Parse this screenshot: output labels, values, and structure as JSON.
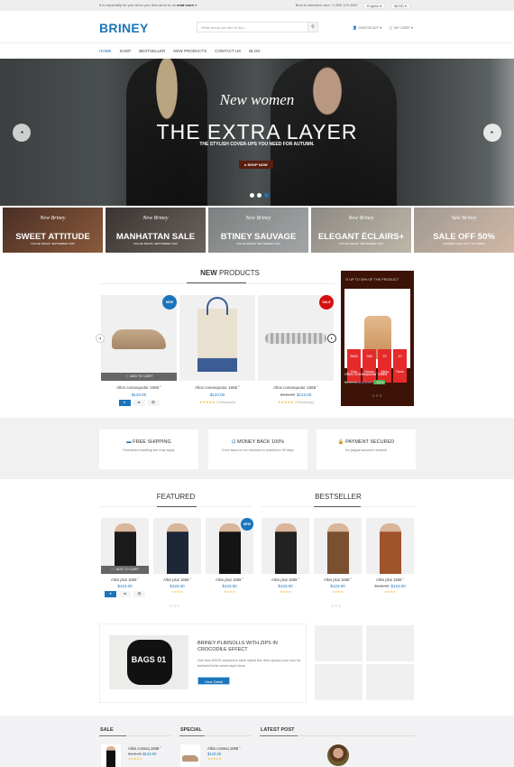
{
  "topbar": {
    "message": "It is especially for you when you first came to us",
    "read_more": "read more »",
    "support": "Best in intensive care +1.800 123 4567",
    "language": "English",
    "currency": "$USD"
  },
  "header": {
    "logo": "BRINEY",
    "search_placeholder": "What would you like to find ...",
    "checkout": "CHECKOUT",
    "cart": "MY CART"
  },
  "nav": [
    "HOME",
    "SHOP",
    "BESTSELLER",
    "NEW PRODUCTS",
    "CONTACT US",
    "BLOG"
  ],
  "hero": {
    "script": "New women",
    "title": "THE EXTRA LAYER",
    "subtitle": "THE STYLISH COVER-UPS YOU NEED FOR AUTUMN.",
    "button": "▸ SHOP NOW",
    "active_slide": 3,
    "slide_count": 3
  },
  "banners": [
    {
      "script": "New Briney",
      "title": "SWEET ATTITUDE",
      "sub": "VOGUE BRAZIL SEPTEMBER 2015",
      "c1": "#4a2f25",
      "c2": "#8b5a3c"
    },
    {
      "script": "New Briney",
      "title": "MANHATTAN SALE",
      "sub": "VOGUE BRAZIL SEPTEMBER 2015",
      "c1": "#3a3533",
      "c2": "#6b625c"
    },
    {
      "script": "New Briney",
      "title": "BTINEY SAUVAGE",
      "sub": "VOGUE BRAZIL SEPTEMBER 2015",
      "c1": "#7d7f80",
      "c2": "#a3a5a6"
    },
    {
      "script": "New Briney",
      "title": "ELEGANT ÉCLAIRS+",
      "sub": "VOGUE BRAZIL SEPTEMBER 2015",
      "c1": "#8d8a84",
      "c2": "#bdb6a8"
    },
    {
      "script": "Sale Briney",
      "title": "SALE OFF 50%",
      "sub": "SUMMER SALE ONLY IN TOWER",
      "c1": "#a09a92",
      "c2": "#d3b8a5"
    }
  ],
  "new_products": {
    "title_bold": "NEW",
    "title_rest": " PRODUCTS",
    "items": [
      {
        "name": "Allos consequutur 1668 ˚",
        "price": "$123.00",
        "old_price": "",
        "badge": "NEW",
        "badge_color": "#1b75bb",
        "add_to_cart": "🛒 ADD TO CART",
        "rating": "",
        "reviews": ""
      },
      {
        "name": "Allos consequutur 1668 ˚",
        "price": "$123.00",
        "old_price": "",
        "badge": "",
        "rating": "★★★★★",
        "reviews": "3 Review(s)"
      },
      {
        "name": "Allos consequutur 1668 ˚",
        "price": "$123.00",
        "old_price": "$145.00",
        "badge": "SALE",
        "badge_color": "#d40f0f",
        "rating": "★★★★★",
        "reviews": "3 Review(s)"
      }
    ],
    "actions": [
      "♥",
      "⇄",
      "👁"
    ]
  },
  "deal": {
    "header": "UP TO 30% OF THE PRODUCT",
    "countdown": [
      {
        "value": "9865",
        "unit": "Day"
      },
      {
        "value": "268",
        "unit": "Hours"
      },
      {
        "value": "23",
        "unit": "Mins"
      },
      {
        "value": "10",
        "unit": "Secs"
      }
    ],
    "name": "Allos consequutur 1668 ˚",
    "old_price": "$145.00",
    "price": "$123.00",
    "discount": "-30%",
    "dots": "○○○"
  },
  "policies": [
    {
      "icon": "▬",
      "title": "FREE SHIPPING",
      "desc": "Oversized handling fee may apply"
    },
    {
      "icon": "⊡",
      "title": "MONEY BACK 100%",
      "desc": "If the issue is not resolved in maximum 30 days"
    },
    {
      "icon": "🔒",
      "title": "PAYMENT SECURED",
      "desc": "No paypal account needed!"
    }
  ],
  "featured": {
    "title": "FEATURED",
    "items": [
      {
        "name": "Allos plus 1668 ˚",
        "price": "$123.00",
        "old_price": "",
        "badge": "",
        "add_to_cart": "🛒 ADD TO CART"
      },
      {
        "name": "Allos plus 1668 ˚",
        "price": "$123.00",
        "old_price": "",
        "badge": "",
        "rating": "★★★★"
      },
      {
        "name": "Allos plus 1668 ˚",
        "price": "$123.00",
        "old_price": "",
        "badge": "NEW",
        "rating": "★★★★"
      },
      {
        "name": "Allos plus 1668 ˚",
        "price": "$123.00",
        "old_price": "",
        "badge": "",
        "rating": "★★★★"
      }
    ],
    "dots": "○○○"
  },
  "bestseller": {
    "title": "BESTSELLER",
    "items": [
      {
        "name": "Allos plus 1668 ˚",
        "price": "$123.00",
        "old_price": "",
        "rating": "★★★★"
      },
      {
        "name": "Allos plus 1668 ˚",
        "price": "$123.00",
        "old_price": "$145.00",
        "rating": "★★★★"
      }
    ],
    "dots": "○○○"
  },
  "promo": {
    "image_label": "BAGS 01",
    "title": "BRINEY PLIMSOLLS WITH ZIPS IN CROCODILE EFFECT",
    "desc": "See how ASOS customers have styled this item upload your own for AsSeenOnMe street-style fame",
    "button": "View Detail"
  },
  "bottom": {
    "sale": {
      "title": "SALE",
      "name": "Allos conseq 1668 ˚",
      "old_price": "$145.00",
      "price": "$123.00",
      "rating": "★★★★★"
    },
    "special": {
      "title": "SPECIAL",
      "name": "Allos conseq 1668 ˚",
      "price": "$123.00",
      "rating": "★★★★★"
    },
    "latest_post": {
      "title": "LATEST POST"
    }
  },
  "colors": {
    "brand": "#1b75bb",
    "sale": "#d40f0f",
    "deal_bg": "#3c1306",
    "countdown": "#e62a2a"
  }
}
